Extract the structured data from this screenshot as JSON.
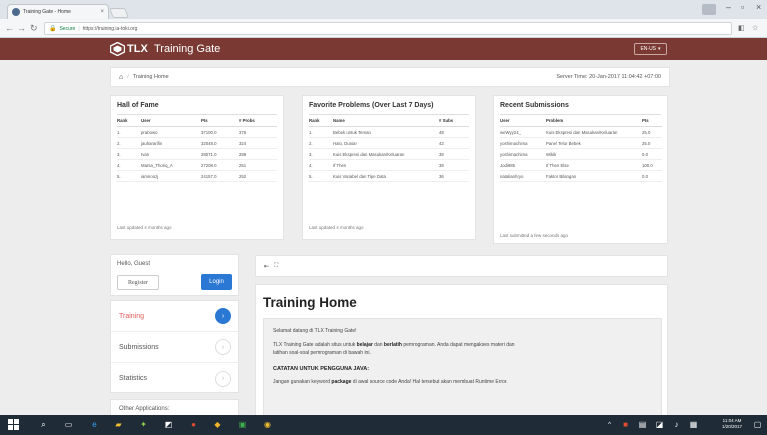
{
  "browser": {
    "tab_title": "Training Gate - Home",
    "tab_close": "×",
    "secure_label": "Secure",
    "url": "https://training.ia-toki.org"
  },
  "navbar": {
    "brand_name": "TLX",
    "brand_sub": "Training Gate",
    "lang_label": "EN-US"
  },
  "breadcrumb": {
    "home_label": "Training Home",
    "server_time": "Server Time: 20-Jan-2017 11:04:42 +07:00"
  },
  "hall_of_fame": {
    "title": "Hall of Fame",
    "headers": [
      "Rank",
      "User",
      "Pts",
      "# Probs"
    ],
    "rows": [
      [
        "1.",
        "prabowo",
        "37100.0",
        "375"
      ],
      [
        "2.",
        "jauhararifin",
        "32048.0",
        "324"
      ],
      [
        "3.",
        "Ivan",
        "28071.0",
        "289"
      ],
      [
        "4.",
        "Marsa_Thoriq_A",
        "27208.0",
        "251"
      ],
      [
        "5.",
        "iamnoozj",
        "24157.0",
        "252"
      ]
    ],
    "footer": "Last updated 4 months ago"
  },
  "favorite_problems": {
    "title": "Favorite Problems (Over Last 7 Days)",
    "headers": [
      "Rank",
      "Name",
      "# Subs"
    ],
    "rows": [
      [
        "1.",
        "Bebek untuk Teman",
        "48"
      ],
      [
        "2.",
        "Halo, Dunia!",
        "42"
      ],
      [
        "3.",
        "Kuis Ekspresi dan Masukan/Keluaran",
        "38"
      ],
      [
        "4.",
        "If Then",
        "38"
      ],
      [
        "5.",
        "Kuis Variabel dan Tipe Data",
        "36"
      ]
    ],
    "footer": "Last updated 4 months ago"
  },
  "recent_submissions": {
    "title": "Recent Submissions",
    "headers": [
      "User",
      "Problem",
      "Pts"
    ],
    "rows": [
      [
        "weWyy24_",
        "Kuis Ekspresi dan Masukan/Keluaran",
        "25.0"
      ],
      [
        "yoshimachima",
        "Panel Telur Bebek",
        "25.0"
      ],
      [
        "yoshimachima",
        "Wikik",
        "0.0"
      ],
      [
        "Jodi985",
        "If Then Else",
        "100.0"
      ],
      [
        "natalianhryo",
        "Faktor Bilangan",
        "0.0"
      ]
    ],
    "footer": "Last submitted a few seconds ago"
  },
  "sidebar": {
    "hello": "Hello, Guest",
    "register_label": "Register",
    "login_label": "Login",
    "menu": [
      {
        "label": "Training",
        "arrow": "›"
      },
      {
        "label": "Submissions",
        "arrow": "›"
      },
      {
        "label": "Statistics",
        "arrow": "›"
      }
    ],
    "other_apps": "Other Applications:"
  },
  "main": {
    "title": "Training Home",
    "welcome": "Selamat datang di TLX Training Gate!",
    "intro_prefix": "TLX Training Gate adalah situs untuk",
    "intro_bold1": "belajar",
    "intro_and": "dan",
    "intro_bold2": "berlatih",
    "intro_suffix": "pemrograman. Anda dapat mengakses materi dan",
    "intro_line2": "latihan soal-soal pemrograman di bawah ini.",
    "java_head": "CATATAN UNTUK PENGGUNA JAVA:",
    "java_prefix": "Jangan gunakan keyword",
    "java_bold": "package",
    "java_suffix": "di awal source code Anda! Hal tersebut akan membuat Runtime Error."
  },
  "taskbar": {
    "time": "11:04 AM",
    "date": "1/20/2017"
  },
  "colors": {
    "navbar": "#7a3a33",
    "primary": "#2b78d4",
    "active_menu": "#e25a5a",
    "taskbar": "#1f2b36"
  }
}
